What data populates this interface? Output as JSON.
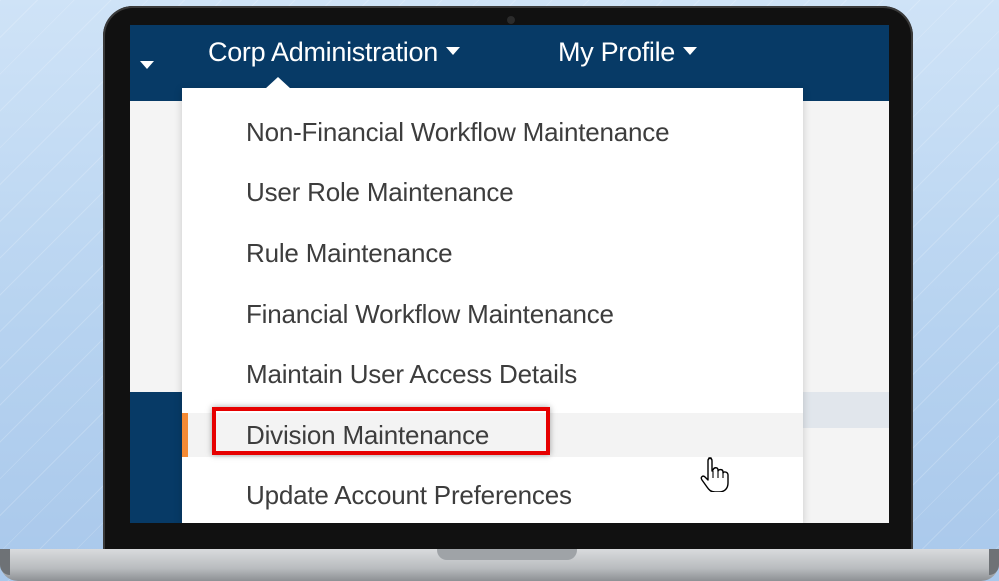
{
  "navbar": {
    "items": [
      {
        "label": "Corp Administration"
      },
      {
        "label": "My Profile"
      }
    ]
  },
  "dropdown": {
    "items": [
      {
        "label": "Non-Financial Workflow Maintenance"
      },
      {
        "label": "User Role Maintenance"
      },
      {
        "label": "Rule Maintenance"
      },
      {
        "label": "Financial Workflow Maintenance"
      },
      {
        "label": "Maintain User Access Details"
      },
      {
        "label": "Division Maintenance"
      },
      {
        "label": "Update Account Preferences"
      }
    ],
    "active_index": 5
  },
  "colors": {
    "navbar": "#073a66",
    "accent": "#f58a34",
    "highlight": "#e60000"
  },
  "icons": [
    "caret-down-icon",
    "hand-pointer-icon"
  ]
}
